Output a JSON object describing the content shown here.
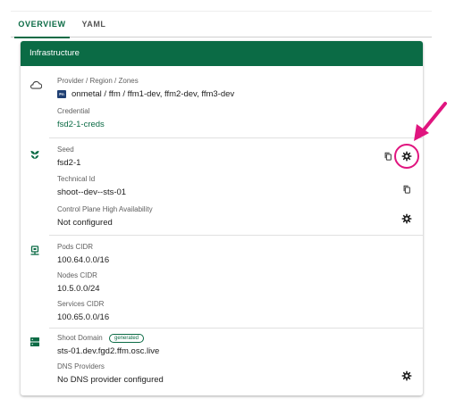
{
  "tabs": [
    {
      "label": "OVERVIEW",
      "active": true
    },
    {
      "label": "YAML",
      "active": false
    }
  ],
  "infrastructure": {
    "title": "Infrastructure",
    "provider": {
      "label": "Provider / Region / Zones",
      "value": "onmetal / ffm / ffm1-dev, ffm2-dev, ffm3-dev",
      "provider_badge": "Fn"
    },
    "credential": {
      "label": "Credential",
      "value": "fsd2-1-creds"
    },
    "seed": {
      "label": "Seed",
      "value": "fsd2-1"
    },
    "technical_id": {
      "label": "Technical Id",
      "value": "shoot--dev--sts-01"
    },
    "control_plane_ha": {
      "label": "Control Plane High Availability",
      "value": "Not configured"
    },
    "pods_cidr": {
      "label": "Pods CIDR",
      "value": "100.64.0.0/16"
    },
    "nodes_cidr": {
      "label": "Nodes CIDR",
      "value": "10.5.0.0/24"
    },
    "services_cidr": {
      "label": "Services CIDR",
      "value": "100.65.0.0/16"
    },
    "shoot_domain": {
      "label": "Shoot Domain",
      "badge": "generated",
      "value": "sts-01.dev.fgd2.ffm.osc.live"
    },
    "dns_providers": {
      "label": "DNS Providers",
      "value": "No DNS provider configured"
    }
  },
  "icons": {
    "cloud": "cloud-outline-icon",
    "seed": "seedling-icon",
    "network": "network-icon",
    "dns": "dns-server-icon",
    "copy": "content-copy-icon",
    "settings": "cog-icon",
    "annotation": "arrow-annotation-icon"
  },
  "colors": {
    "primary": "#0b6b45",
    "annotation": "#e0157f",
    "provider_badge": "#1f3f73"
  }
}
